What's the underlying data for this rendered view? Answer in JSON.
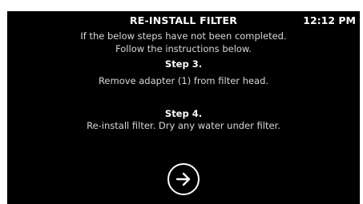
{
  "header": {
    "title": "RE-INSTALL FILTER",
    "time": "12:12 PM"
  },
  "intro": {
    "line1": "If the below steps have not been completed.",
    "line2": "Follow the instructions below."
  },
  "steps": [
    {
      "label": "Step 3.",
      "text": "Remove adapter (1) from filter head."
    },
    {
      "label": "Step 4.",
      "text": "Re-install filter. Dry any water under filter."
    }
  ],
  "next_button": {
    "icon": "arrow-right-circle-icon"
  },
  "colors": {
    "background": "#000000",
    "text": "#ffffff"
  }
}
